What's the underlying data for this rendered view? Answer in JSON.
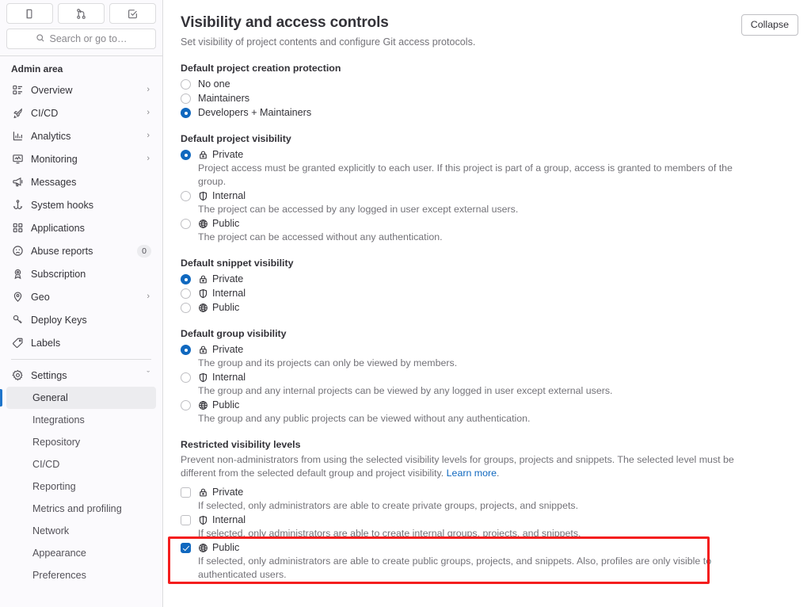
{
  "sidebar": {
    "top_icons": [
      {
        "name": "issues-icon",
        "glyph": "issues"
      },
      {
        "name": "merge-requests-icon",
        "glyph": "merge"
      },
      {
        "name": "todos-icon",
        "glyph": "todo"
      }
    ],
    "search": {
      "placeholder": "Search or go to…",
      "label": "Search or go to…"
    },
    "heading": "Admin area",
    "items": [
      {
        "label": "Overview",
        "icon": "overview-icon",
        "chevron": "›",
        "badge": ""
      },
      {
        "label": "CI/CD",
        "icon": "rocket-icon",
        "chevron": "›",
        "badge": ""
      },
      {
        "label": "Analytics",
        "icon": "chart-icon",
        "chevron": "›",
        "badge": ""
      },
      {
        "label": "Monitoring",
        "icon": "monitor-icon",
        "chevron": "›",
        "badge": ""
      },
      {
        "label": "Messages",
        "icon": "megaphone-icon",
        "chevron": "",
        "badge": ""
      },
      {
        "label": "System hooks",
        "icon": "hook-icon",
        "chevron": "",
        "badge": ""
      },
      {
        "label": "Applications",
        "icon": "applications-icon",
        "chevron": "",
        "badge": ""
      },
      {
        "label": "Abuse reports",
        "icon": "abuse-icon",
        "chevron": "",
        "badge": "0"
      },
      {
        "label": "Subscription",
        "icon": "subscription-icon",
        "chevron": "",
        "badge": ""
      },
      {
        "label": "Geo",
        "icon": "location-icon",
        "chevron": "›",
        "badge": ""
      },
      {
        "label": "Deploy Keys",
        "icon": "key-icon",
        "chevron": "",
        "badge": ""
      },
      {
        "label": "Labels",
        "icon": "label-icon",
        "chevron": "",
        "badge": ""
      }
    ],
    "settings": {
      "label": "Settings",
      "icon": "gear-icon",
      "chevron": "ˇ"
    },
    "settings_items": [
      {
        "label": "General",
        "active": true
      },
      {
        "label": "Integrations",
        "active": false
      },
      {
        "label": "Repository",
        "active": false
      },
      {
        "label": "CI/CD",
        "active": false
      },
      {
        "label": "Reporting",
        "active": false
      },
      {
        "label": "Metrics and profiling",
        "active": false
      },
      {
        "label": "Network",
        "active": false
      },
      {
        "label": "Appearance",
        "active": false
      },
      {
        "label": "Preferences",
        "active": false
      }
    ]
  },
  "header": {
    "title": "Visibility and access controls",
    "subtitle": "Set visibility of project contents and configure Git access protocols.",
    "collapse_label": "Collapse"
  },
  "sections": {
    "creation_protection": {
      "legend": "Default project creation protection",
      "options": [
        {
          "label": "No one",
          "checked": false,
          "icon": "",
          "help": ""
        },
        {
          "label": "Maintainers",
          "checked": false,
          "icon": "",
          "help": ""
        },
        {
          "label": "Developers + Maintainers",
          "checked": true,
          "icon": "",
          "help": ""
        }
      ]
    },
    "project_visibility": {
      "legend": "Default project visibility",
      "options": [
        {
          "label": "Private",
          "checked": true,
          "icon": "lock-icon",
          "help": "Project access must be granted explicitly to each user. If this project is part of a group, access is granted to members of the group."
        },
        {
          "label": "Internal",
          "checked": false,
          "icon": "shield-icon",
          "help": "The project can be accessed by any logged in user except external users."
        },
        {
          "label": "Public",
          "checked": false,
          "icon": "globe-icon",
          "help": "The project can be accessed without any authentication."
        }
      ]
    },
    "snippet_visibility": {
      "legend": "Default snippet visibility",
      "options": [
        {
          "label": "Private",
          "checked": true,
          "icon": "lock-icon",
          "help": ""
        },
        {
          "label": "Internal",
          "checked": false,
          "icon": "shield-icon",
          "help": ""
        },
        {
          "label": "Public",
          "checked": false,
          "icon": "globe-icon",
          "help": ""
        }
      ]
    },
    "group_visibility": {
      "legend": "Default group visibility",
      "options": [
        {
          "label": "Private",
          "checked": true,
          "icon": "lock-icon",
          "help": "The group and its projects can only be viewed by members."
        },
        {
          "label": "Internal",
          "checked": false,
          "icon": "shield-icon",
          "help": "The group and any internal projects can be viewed by any logged in user except external users."
        },
        {
          "label": "Public",
          "checked": false,
          "icon": "globe-icon",
          "help": "The group and any public projects can be viewed without any authentication."
        }
      ]
    },
    "restricted_levels": {
      "legend": "Restricted visibility levels",
      "description": "Prevent non-administrators from using the selected visibility levels for groups, projects and snippets. The selected level must be different from the selected default group and project visibility. ",
      "link_text": "Learn more",
      "description_tail": ".",
      "options": [
        {
          "label": "Private",
          "checked": false,
          "icon": "lock-icon",
          "help": "If selected, only administrators are able to create private groups, projects, and snippets."
        },
        {
          "label": "Internal",
          "checked": false,
          "icon": "shield-icon",
          "help": "If selected, only administrators are able to create internal groups, projects, and snippets."
        },
        {
          "label": "Public",
          "checked": true,
          "icon": "globe-icon",
          "help": "If selected, only administrators are able to create public groups, projects, and snippets. Also, profiles are only visible to authenticated users."
        }
      ]
    }
  },
  "colors": {
    "accent": "#1068bf",
    "highlight": "#f41e1e",
    "sidebar_bg": "#fbfafd",
    "text": "#333238",
    "muted": "#737278"
  }
}
